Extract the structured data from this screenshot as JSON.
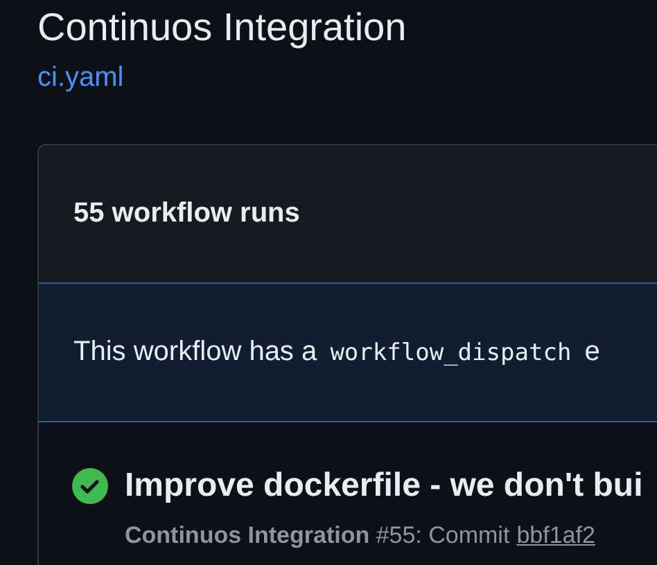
{
  "workflow": {
    "title": "Continuos Integration",
    "file_link": "ci.yaml"
  },
  "runs_panel": {
    "heading": "55 workflow runs",
    "banner": {
      "text_before": "This workflow has a",
      "code": "workflow_dispatch",
      "text_after": "e"
    },
    "runs": [
      {
        "succeeded": true,
        "title": "Improve dockerfile - we don't bui",
        "subtitle": "**Continuos Integration** #55: Commit",
        "commit": "bbf1af2"
      }
    ]
  }
}
